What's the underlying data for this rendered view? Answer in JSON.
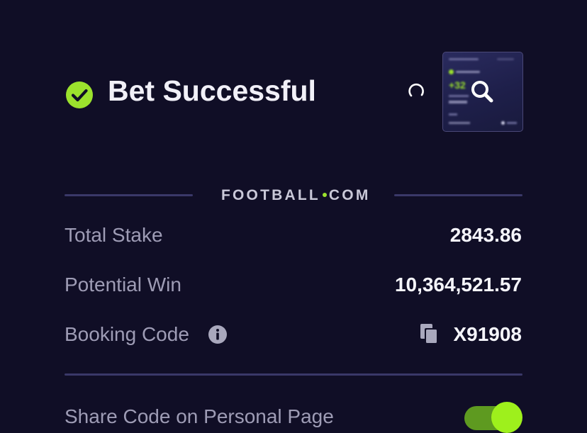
{
  "header": {
    "title": "Bet Successful",
    "check_icon": "check-circle-icon",
    "loading_icon": "spinner-icon"
  },
  "preview": {
    "thumbnail_text": "+32",
    "zoom_icon": "search-icon"
  },
  "brand": {
    "name_left": "FOOTBALL",
    "name_right": "COM"
  },
  "summary": {
    "total_stake_label": "Total Stake",
    "total_stake_value": "2843.86",
    "potential_win_label": "Potential Win",
    "potential_win_value": "10,364,521.57",
    "booking_code_label": "Booking Code",
    "booking_code_value": "X91908",
    "info_icon": "info-icon",
    "copy_icon": "copy-icon"
  },
  "share": {
    "label": "Share Code on Personal Page",
    "enabled": true
  },
  "colors": {
    "background": "#100e26",
    "accent_green": "#9be22d",
    "divider": "#3a3868",
    "label_text": "#9e9cb5",
    "value_text": "#f5f5fb"
  }
}
